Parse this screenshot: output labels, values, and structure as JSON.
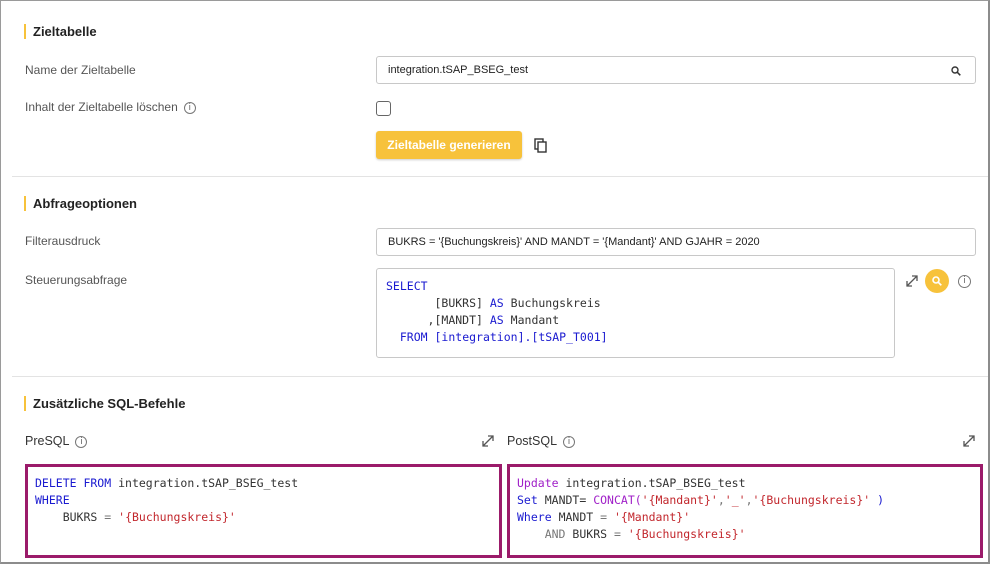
{
  "target_section": {
    "title": "Zieltabelle",
    "name_label": "Name der Zieltabelle",
    "name_value": "integration.tSAP_BSEG_test",
    "clear_label": "Inhalt der Zieltabelle löschen",
    "clear_checked": false,
    "generate_button": "Zieltabelle generieren"
  },
  "query_section": {
    "title": "Abfrageoptionen",
    "filter_label": "Filterausdruck",
    "filter_value": "BUKRS = '{Buchungskreis}' AND MANDT = '{Mandant}' AND GJAHR = 2020",
    "control_label": "Steuerungsabfrage",
    "control_sql": {
      "l1": "SELECT",
      "l2_a": "[BUKRS]",
      "l2_kw": "AS",
      "l2_b": "Buchungskreis",
      "l3_a": ",[MANDT]",
      "l3_kw": "AS",
      "l3_b": "Mandant",
      "l4_kw": "FROM",
      "l4_a": "[integration]",
      "l4_b": ".[tSAP_T001]"
    }
  },
  "sql_section": {
    "title": "Zusätzliche SQL-Befehle",
    "presql_label": "PreSQL",
    "postsql_label": "PostSQL",
    "presql": {
      "l1_kw": "DELETE FROM",
      "l1_a": "integration.tSAP_BSEG_test",
      "l2_kw": "WHERE",
      "l3_a": "BUKRS",
      "l3_op": "=",
      "l3_str": "'{Buchungskreis}'"
    },
    "postsql": {
      "l1_kw": "Update",
      "l1_a": "integration.tSAP_BSEG_test",
      "l2_kw": "Set",
      "l2_a": "MANDT=",
      "l2_fn": "CONCAT(",
      "l2_s1": "'{Mandant}'",
      "l2_c1": ",",
      "l2_s2": "'_'",
      "l2_c2": ",",
      "l2_s3": "'{Buchungskreis}'",
      "l2_end": " )",
      "l3_kw": "Where",
      "l3_a": "MANDT",
      "l3_op": "=",
      "l3_str": "'{Mandant}'",
      "l4_kw": "AND",
      "l4_a": "BUKRS",
      "l4_op": "=",
      "l4_str": "'{Buchungskreis}'"
    }
  },
  "colors": {
    "accent": "#f7c23b",
    "highlight_border": "#9b1b6a",
    "keyword": "#1a1ad0",
    "string": "#c2272d"
  }
}
